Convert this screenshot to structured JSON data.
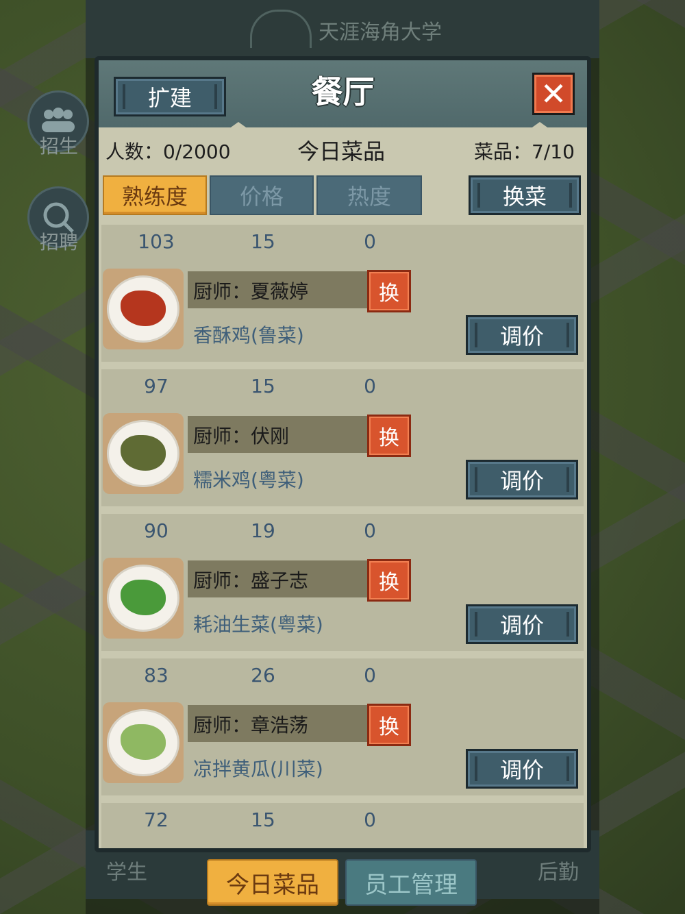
{
  "background": {
    "school_name": "天涯海角大学",
    "side_buttons": [
      {
        "label": "招生",
        "icon": "people-icon"
      },
      {
        "label": "招聘",
        "icon": "search-person-icon"
      }
    ],
    "bottom_left": "学生",
    "bottom_right": "后勤"
  },
  "dialog": {
    "title": "餐厅",
    "expand_label": "扩建",
    "close_icon": "close-icon",
    "people_label": "人数：0/2000",
    "today_label": "今日菜品",
    "dishes_count_label": "菜品：7/10",
    "tabs": [
      {
        "label": "熟练度",
        "active": true
      },
      {
        "label": "价格",
        "active": false
      },
      {
        "label": "热度",
        "active": false
      }
    ],
    "change_dishes_label": "换菜",
    "rows": [
      {
        "proficiency": "103",
        "price": "15",
        "heat": "0",
        "chef": "厨师：夏薇婷",
        "swap": "换",
        "dish": "香酥鸡(鲁菜)",
        "adjust": "调价",
        "food_color": "#b5361e"
      },
      {
        "proficiency": "97",
        "price": "15",
        "heat": "0",
        "chef": "厨师：伏刚",
        "swap": "换",
        "dish": "糯米鸡(粤菜)",
        "adjust": "调价",
        "food_color": "#5f6b34"
      },
      {
        "proficiency": "90",
        "price": "19",
        "heat": "0",
        "chef": "厨师：盛子志",
        "swap": "换",
        "dish": "耗油生菜(粤菜)",
        "adjust": "调价",
        "food_color": "#4a9a3a"
      },
      {
        "proficiency": "83",
        "price": "26",
        "heat": "0",
        "chef": "厨师：章浩荡",
        "swap": "换",
        "dish": "凉拌黄瓜(川菜)",
        "adjust": "调价",
        "food_color": "#8fb862"
      },
      {
        "proficiency": "72",
        "price": "15",
        "heat": "0"
      }
    ]
  },
  "bottom_tabs": [
    {
      "label": "今日菜品",
      "active": true
    },
    {
      "label": "员工管理",
      "active": false
    }
  ]
}
